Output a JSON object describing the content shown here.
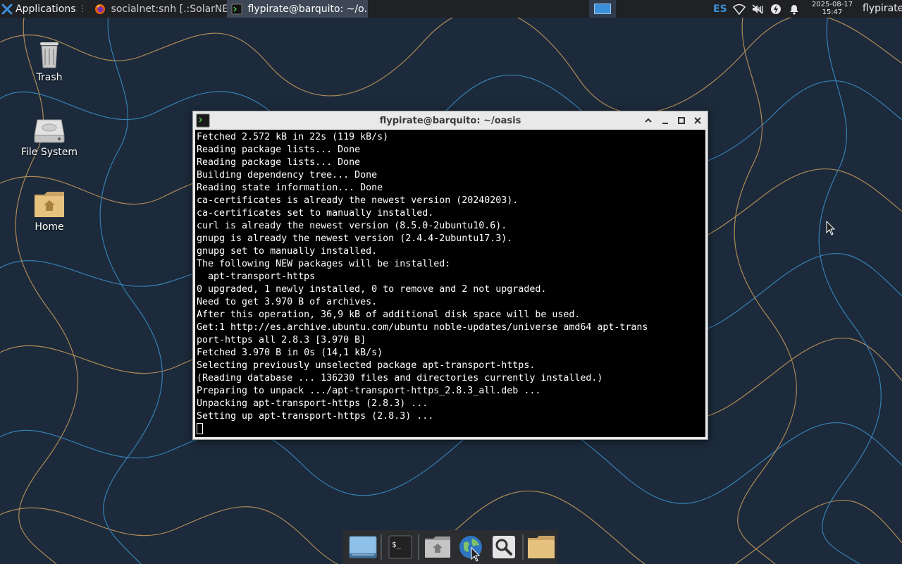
{
  "panel": {
    "applications_label": "Applications",
    "applications_separator": "⋮",
    "tasks": [
      {
        "label": "socialnet:snh [.:SolarNE...",
        "icon": "firefox-icon"
      },
      {
        "label": "flypirate@barquito: ~/o...",
        "icon": "terminal-icon",
        "active": true
      }
    ],
    "keyboard_layout": "ES",
    "clock_date": "2025-08-17",
    "clock_time": "15:47",
    "username": "flypirate"
  },
  "desktop": {
    "icons": [
      {
        "label": "Trash",
        "icon": "trash-icon"
      },
      {
        "label": "File System",
        "icon": "drive-icon"
      },
      {
        "label": "Home",
        "icon": "home-folder-icon"
      }
    ]
  },
  "terminal": {
    "title": "flypirate@barquito: ~/oasis",
    "lines": [
      "Fetched 2.572 kB in 22s (119 kB/s)",
      "Reading package lists... Done",
      "Reading package lists... Done",
      "Building dependency tree... Done",
      "Reading state information... Done",
      "ca-certificates is already the newest version (20240203).",
      "ca-certificates set to manually installed.",
      "curl is already the newest version (8.5.0-2ubuntu10.6).",
      "gnupg is already the newest version (2.4.4-2ubuntu17.3).",
      "gnupg set to manually installed.",
      "The following NEW packages will be installed:",
      "  apt-transport-https",
      "0 upgraded, 1 newly installed, 0 to remove and 2 not upgraded.",
      "Need to get 3.970 B of archives.",
      "After this operation, 36,9 kB of additional disk space will be used.",
      "Get:1 http://es.archive.ubuntu.com/ubuntu noble-updates/universe amd64 apt-trans",
      "port-https all 2.8.3 [3.970 B]",
      "Fetched 3.970 B in 0s (14,1 kB/s)",
      "Selecting previously unselected package apt-transport-https.",
      "(Reading database ... 136230 files and directories currently installed.)",
      "Preparing to unpack .../apt-transport-https_2.8.3_all.deb ...",
      "Unpacking apt-transport-https (2.8.3) ...",
      "Setting up apt-transport-https (2.8.3) ..."
    ]
  },
  "dock": {
    "items": [
      "show-desktop-icon",
      "terminal-icon",
      "home-folder-icon",
      "web-browser-icon",
      "search-icon",
      "folder-icon"
    ]
  },
  "colors": {
    "panel_bg": "#1f2125",
    "accent": "#3b8fd9",
    "terminal_bg": "#000000",
    "terminal_fg": "#ffffff",
    "wallpaper_bg": "#1c2a3b"
  }
}
